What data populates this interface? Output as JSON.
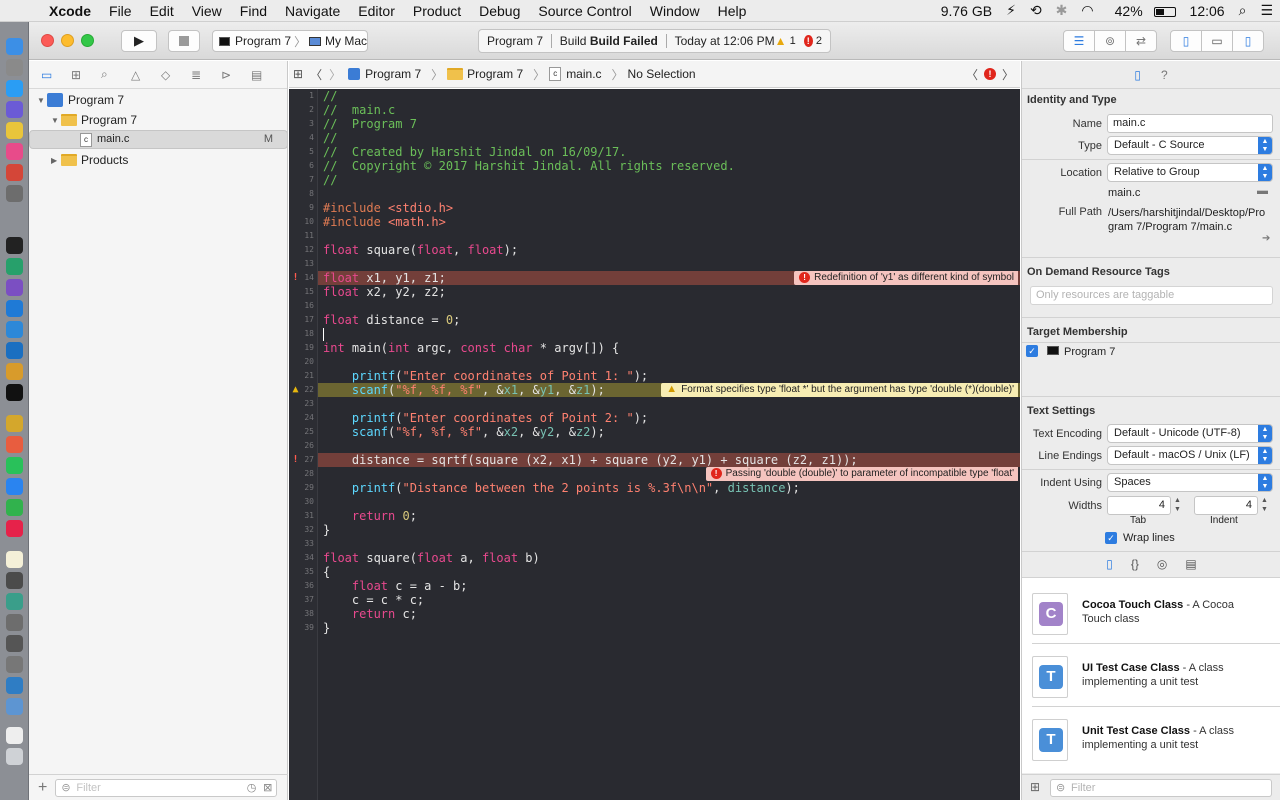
{
  "menubar": {
    "items": [
      "Xcode",
      "File",
      "Edit",
      "View",
      "Find",
      "Navigate",
      "Editor",
      "Product",
      "Debug",
      "Source Control",
      "Window",
      "Help"
    ],
    "memory": "9.76 GB",
    "battery": "42%",
    "clock": "12:06"
  },
  "toolbar": {
    "scheme_target": "Program 7",
    "scheme_device": "My Mac",
    "activity": {
      "project": "Program 7",
      "status": "Build Failed",
      "time": "Today at 12:06 PM",
      "warnings": "1",
      "errors": "2"
    }
  },
  "navigator": {
    "project": "Program 7",
    "group": "Program 7",
    "file": "main.c",
    "file_badge": "M",
    "products": "Products",
    "filter_placeholder": "Filter"
  },
  "jumpbar": {
    "crumbs": [
      "Program 7",
      "Program 7",
      "main.c",
      "No Selection"
    ]
  },
  "code": {
    "lines": [
      "1",
      "2",
      "3",
      "4",
      "5",
      "6",
      "7",
      "8",
      "9",
      "10",
      "11",
      "12",
      "13",
      "14",
      "15",
      "16",
      "17",
      "18",
      "19",
      "20",
      "21",
      "22",
      "23",
      "24",
      "25",
      "26",
      "27",
      "28",
      "29",
      "30",
      "31",
      "32",
      "33",
      "34",
      "35",
      "36",
      "37",
      "38",
      "39"
    ],
    "issues": {
      "err1": "Redefinition of 'y1' as different kind of symbol",
      "warn1": "Format specifies type 'float *' but the argument has type 'double (*)(double)'",
      "err2": "Passing 'double (double)' to parameter of incompatible type 'float'"
    }
  },
  "code_text": {
    "l1": "//",
    "l2": "//  main.c",
    "l3": "//  Program 7",
    "l4": "//",
    "l5": "//  Created by Harshit Jindal on 16/09/17.",
    "l6": "//  Copyright © 2017 Harshit Jindal. All rights reserved.",
    "l7": "//",
    "l9a": "#include ",
    "l9b": "<stdio.h>",
    "l10a": "#include ",
    "l10b": "<math.h>",
    "l12a": "float",
    "l12b": " square(",
    "l12c": "float",
    "l12d": ", ",
    "l12e": "float",
    "l12f": ");",
    "l14a": "float",
    "l14b": " x1, y1, z1;",
    "l15a": "float",
    "l15b": " x2, y2, z2;",
    "l17a": "float",
    "l17b": " distance = ",
    "l17c": "0",
    "l17d": ";",
    "l19a": "int",
    "l19b": " main(",
    "l19c": "int",
    "l19d": " argc, ",
    "l19e": "const",
    "l19f": " ",
    "l19g": "char",
    "l19h": " * argv[]) {",
    "l21a": "    ",
    "l21b": "printf",
    "l21c": "(",
    "l21d": "\"Enter coordinates of Point 1: \"",
    "l21e": ");",
    "l22a": "    ",
    "l22b": "scanf",
    "l22c": "(",
    "l22d": "\"%f, %f, %f\"",
    "l22e": ", &",
    "l22f": "x1",
    "l22g": ", &",
    "l22h": "y1",
    "l22i": ", &",
    "l22j": "z1",
    "l22k": ");",
    "l24a": "    ",
    "l24b": "printf",
    "l24c": "(",
    "l24d": "\"Enter coordinates of Point 2: \"",
    "l24e": ");",
    "l25a": "    ",
    "l25b": "scanf",
    "l25c": "(",
    "l25d": "\"%f, %f, %f\"",
    "l25e": ", &",
    "l25f": "x2",
    "l25g": ", &",
    "l25h": "y2",
    "l25i": ", &",
    "l25j": "z2",
    "l25k": ");",
    "l27": "    distance = sqrtf(square (x2, x1) + square (y2, y1) + square (z2, z1));",
    "l29a": "    ",
    "l29b": "printf",
    "l29c": "(",
    "l29d": "\"Distance between the 2 points is %.3f\\n\\n\"",
    "l29e": ", ",
    "l29f": "distance",
    "l29g": ");",
    "l31a": "    ",
    "l31b": "return",
    "l31c": " ",
    "l31d": "0",
    "l31e": ";",
    "l32": "}",
    "l34a": "float",
    "l34b": " square(",
    "l34c": "float",
    "l34d": " a, ",
    "l34e": "float",
    "l34f": " b)",
    "l35": "{",
    "l36a": "    ",
    "l36b": "float",
    "l36c": " c = a - b;",
    "l37": "    c = c * c;",
    "l38a": "    ",
    "l38b": "return",
    "l38c": " c;",
    "l39": "}"
  },
  "inspector": {
    "identity_title": "Identity and Type",
    "name_label": "Name",
    "name_value": "main.c",
    "type_label": "Type",
    "type_value": "Default - C Source",
    "location_label": "Location",
    "location_value": "Relative to Group",
    "location_file": "main.c",
    "fullpath_label": "Full Path",
    "fullpath_value": "/Users/harshitjindal/Desktop/Program 7/Program 7/main.c",
    "odr_title": "On Demand Resource Tags",
    "odr_placeholder": "Only resources are taggable",
    "target_title": "Target Membership",
    "target_name": "Program 7",
    "text_title": "Text Settings",
    "encoding_label": "Text Encoding",
    "encoding_value": "Default - Unicode (UTF-8)",
    "endings_label": "Line Endings",
    "endings_value": "Default - macOS / Unix (LF)",
    "indent_label": "Indent Using",
    "indent_value": "Spaces",
    "widths_label": "Widths",
    "tab_value": "4",
    "indent_width_value": "4",
    "tab_caption": "Tab",
    "indent_caption": "Indent",
    "wrap_label": "Wrap lines",
    "library": [
      {
        "title": "Cocoa Touch Class",
        "desc": " - A Cocoa Touch class",
        "glyph": "C"
      },
      {
        "title": "UI Test Case Class",
        "desc": " - A class implementing a unit test",
        "glyph": "T"
      },
      {
        "title": "Unit Test Case Class",
        "desc": " - A class implementing a unit test",
        "glyph": "T"
      }
    ],
    "filter_placeholder": "Filter"
  }
}
